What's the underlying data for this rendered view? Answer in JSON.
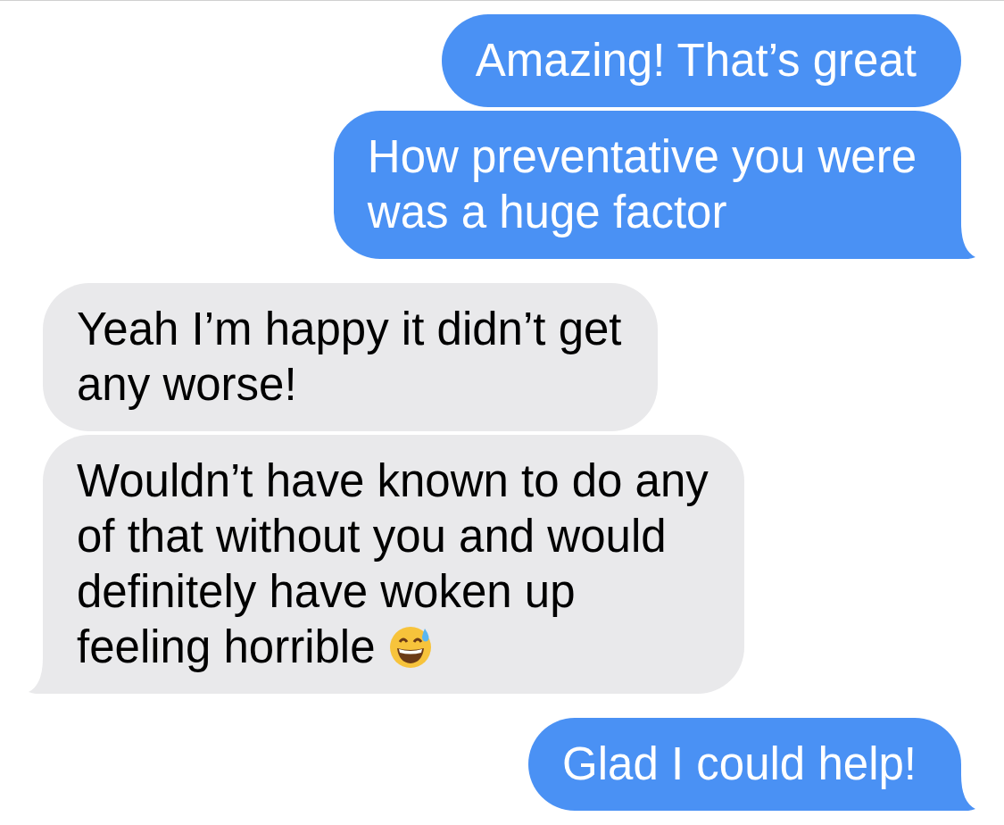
{
  "messages": [
    {
      "kind": "sent",
      "lines": [
        "Amazing! That’s great"
      ],
      "tail": false
    },
    {
      "kind": "sent",
      "lines": [
        "How preventative you were",
        "was a huge factor"
      ],
      "tail": true
    },
    {
      "kind": "received",
      "lines": [
        "Yeah I’m happy it didn’t get",
        "any worse!"
      ],
      "tail": false
    },
    {
      "kind": "received",
      "lines": [
        "Wouldn’t have known to do any",
        "of that without you and would",
        "definitely have woken up",
        "feeling horrible"
      ],
      "tail": true,
      "emoji": true
    },
    {
      "kind": "sent",
      "lines": [
        "Glad I could help!"
      ],
      "tail": true
    }
  ]
}
